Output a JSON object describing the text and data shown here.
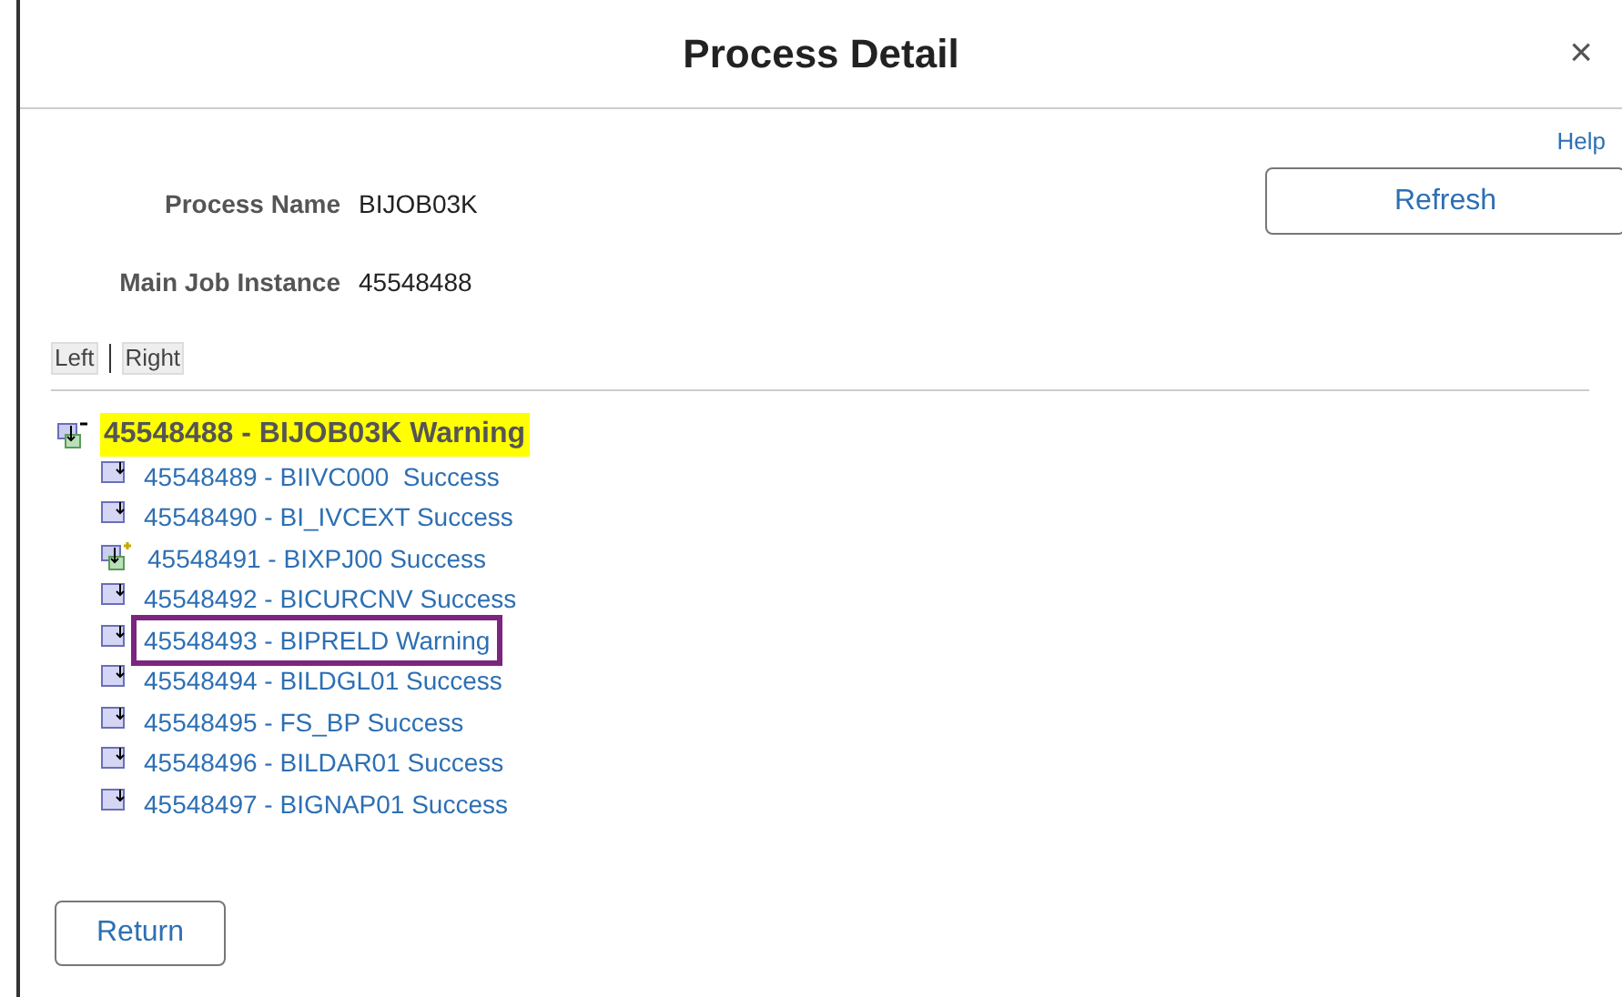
{
  "dialog": {
    "title": "Process Detail",
    "close": "×"
  },
  "help_link": "Help",
  "refresh_button": "Refresh",
  "fields": [
    {
      "label": "Process Name",
      "value": "BIJOB03K"
    },
    {
      "label": "Main Job Instance",
      "value": "45548488"
    }
  ],
  "view_buttons": [
    {
      "label": "Left"
    },
    {
      "label": "Right"
    }
  ],
  "tree": {
    "label": "45548488 - BIJOB03K Warning",
    "kind": "job",
    "expanded": true,
    "highlighted": true,
    "children": [
      {
        "label": "45548489 - BIIVC000  Success",
        "kind": "process",
        "boxed": false
      },
      {
        "label": "45548490 - BI_IVCEXT Success",
        "kind": "process",
        "boxed": false
      },
      {
        "label": "45548491 - BIXPJ00 Success",
        "kind": "job",
        "expanded": false,
        "boxed": false
      },
      {
        "label": "45548492 - BICURCNV Success",
        "kind": "process",
        "boxed": false
      },
      {
        "label": "45548493 - BIPRELD Warning",
        "kind": "process",
        "boxed": true
      },
      {
        "label": "45548494 - BILDGL01 Success",
        "kind": "process",
        "boxed": false
      },
      {
        "label": "45548495 - FS_BP Success",
        "kind": "process",
        "boxed": false
      },
      {
        "label": "45548496 - BILDAR01 Success",
        "kind": "process",
        "boxed": false
      },
      {
        "label": "45548497 - BIGNAP01 Success",
        "kind": "process",
        "boxed": false
      }
    ]
  },
  "return_button": "Return"
}
